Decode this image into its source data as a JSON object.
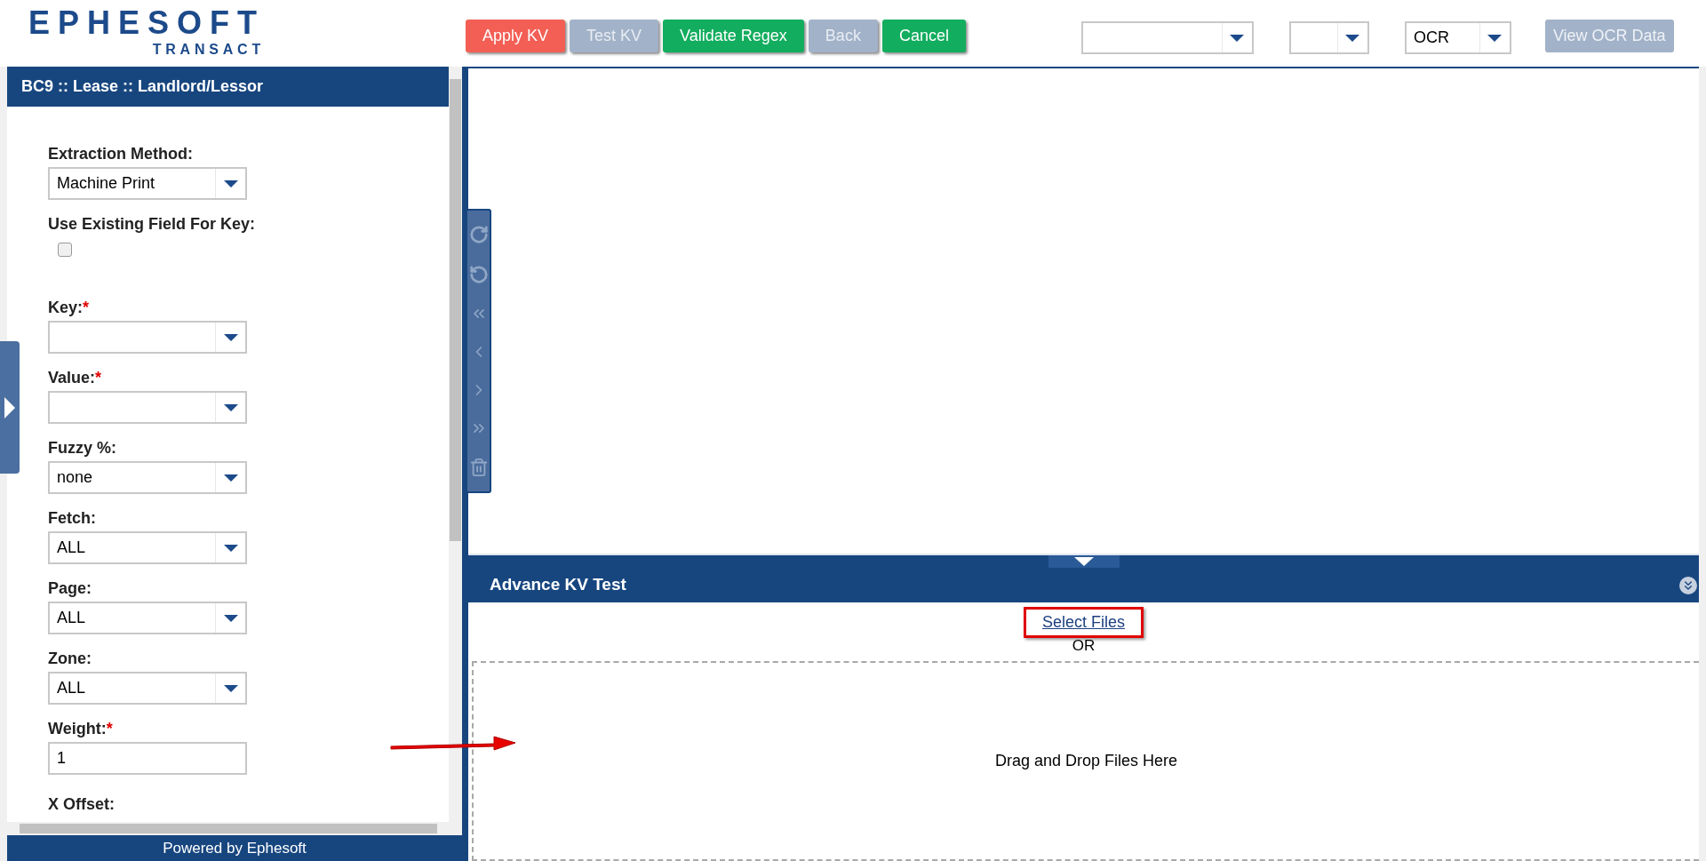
{
  "logo": {
    "brand": "EPHESOFT",
    "product": "TRANSACT"
  },
  "toolbar": {
    "buttons": [
      {
        "label": "Apply KV",
        "color": "#f35f55",
        "disabled": false
      },
      {
        "label": "Test KV",
        "color": "#a2b2c8",
        "disabled": true
      },
      {
        "label": "Validate Regex",
        "color": "#12ad5e",
        "disabled": false
      },
      {
        "label": "Back",
        "color": "#a2b2c8",
        "disabled": true
      },
      {
        "label": "Cancel",
        "color": "#12ad5e",
        "disabled": false
      }
    ],
    "dropdowns": [
      {
        "kind": "wide"
      },
      {
        "kind": "narrow"
      },
      {
        "kind": "medium",
        "value": "OCR"
      }
    ],
    "view_button": {
      "label": "View OCR Data",
      "disabled": true
    }
  },
  "left_panel": {
    "title": "BC9 :: Lease :: Landlord/Lessor",
    "fields": [
      {
        "kind": "select",
        "label": "Extraction Method:",
        "value": "Machine Print"
      },
      {
        "kind": "checkbox",
        "label": "Use Existing Field For Key:",
        "checked": false
      },
      {
        "kind": "select",
        "label": "Key:",
        "marker": "*"
      },
      {
        "kind": "select",
        "label": "Value:",
        "marker": "*"
      },
      {
        "kind": "select",
        "label": "Fuzzy %:",
        "value": "none"
      },
      {
        "kind": "select",
        "label": "Fetch:",
        "value": "ALL"
      },
      {
        "kind": "select",
        "label": "Page:",
        "value": "ALL"
      },
      {
        "kind": "select",
        "label": "Zone:",
        "value": "ALL"
      },
      {
        "kind": "input",
        "label": "Weight:",
        "marker": "*",
        "value": "1"
      },
      {
        "kind": "heading",
        "label": "X Offset:"
      }
    ],
    "footer": "Powered by Ephesoft"
  },
  "test_panel": {
    "title": "Advance KV Test",
    "select_link": "Select Files",
    "or": "OR",
    "drop_hint": "Drag and Drop Files Here"
  }
}
